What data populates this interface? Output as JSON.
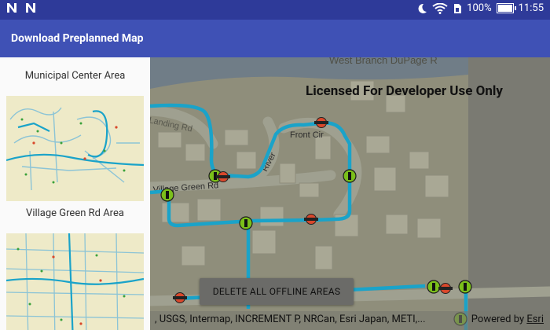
{
  "status_bar": {
    "left_icons": [
      "n-notification-icon",
      "n-notification-icon"
    ],
    "right_icons": [
      "do-not-disturb-moon-icon",
      "wifi-icon",
      "sim-no-signal-icon"
    ],
    "battery_percent": "100%",
    "battery_level": 1.0,
    "time": "11:55"
  },
  "app_bar": {
    "title": "Download Preplanned Map"
  },
  "sidebar": {
    "areas": [
      {
        "label": "Municipal Center Area"
      },
      {
        "label": "Village Green Rd Area"
      },
      {
        "label": ""
      }
    ]
  },
  "map": {
    "watermark": "Licensed For Developer Use Only",
    "street_labels": [
      "West Branch DuPage R",
      "Landing Rd",
      "Front Cir",
      "River",
      "Village Green Rd"
    ],
    "delete_button": "DELETE ALL OFFLINE AREAS",
    "attribution": ", USGS, Intermap, INCREMENT P, NRCan, Esri Japan, METI,...",
    "powered_by_prefix": "Powered by ",
    "powered_by_link": "Esri"
  },
  "colors": {
    "status_bar": "#2e3a99",
    "app_bar": "#3f51b5",
    "pipeline": "#1aa3c9",
    "valve_green": "#7bbf1a",
    "hydrant_red": "#d9482b"
  }
}
